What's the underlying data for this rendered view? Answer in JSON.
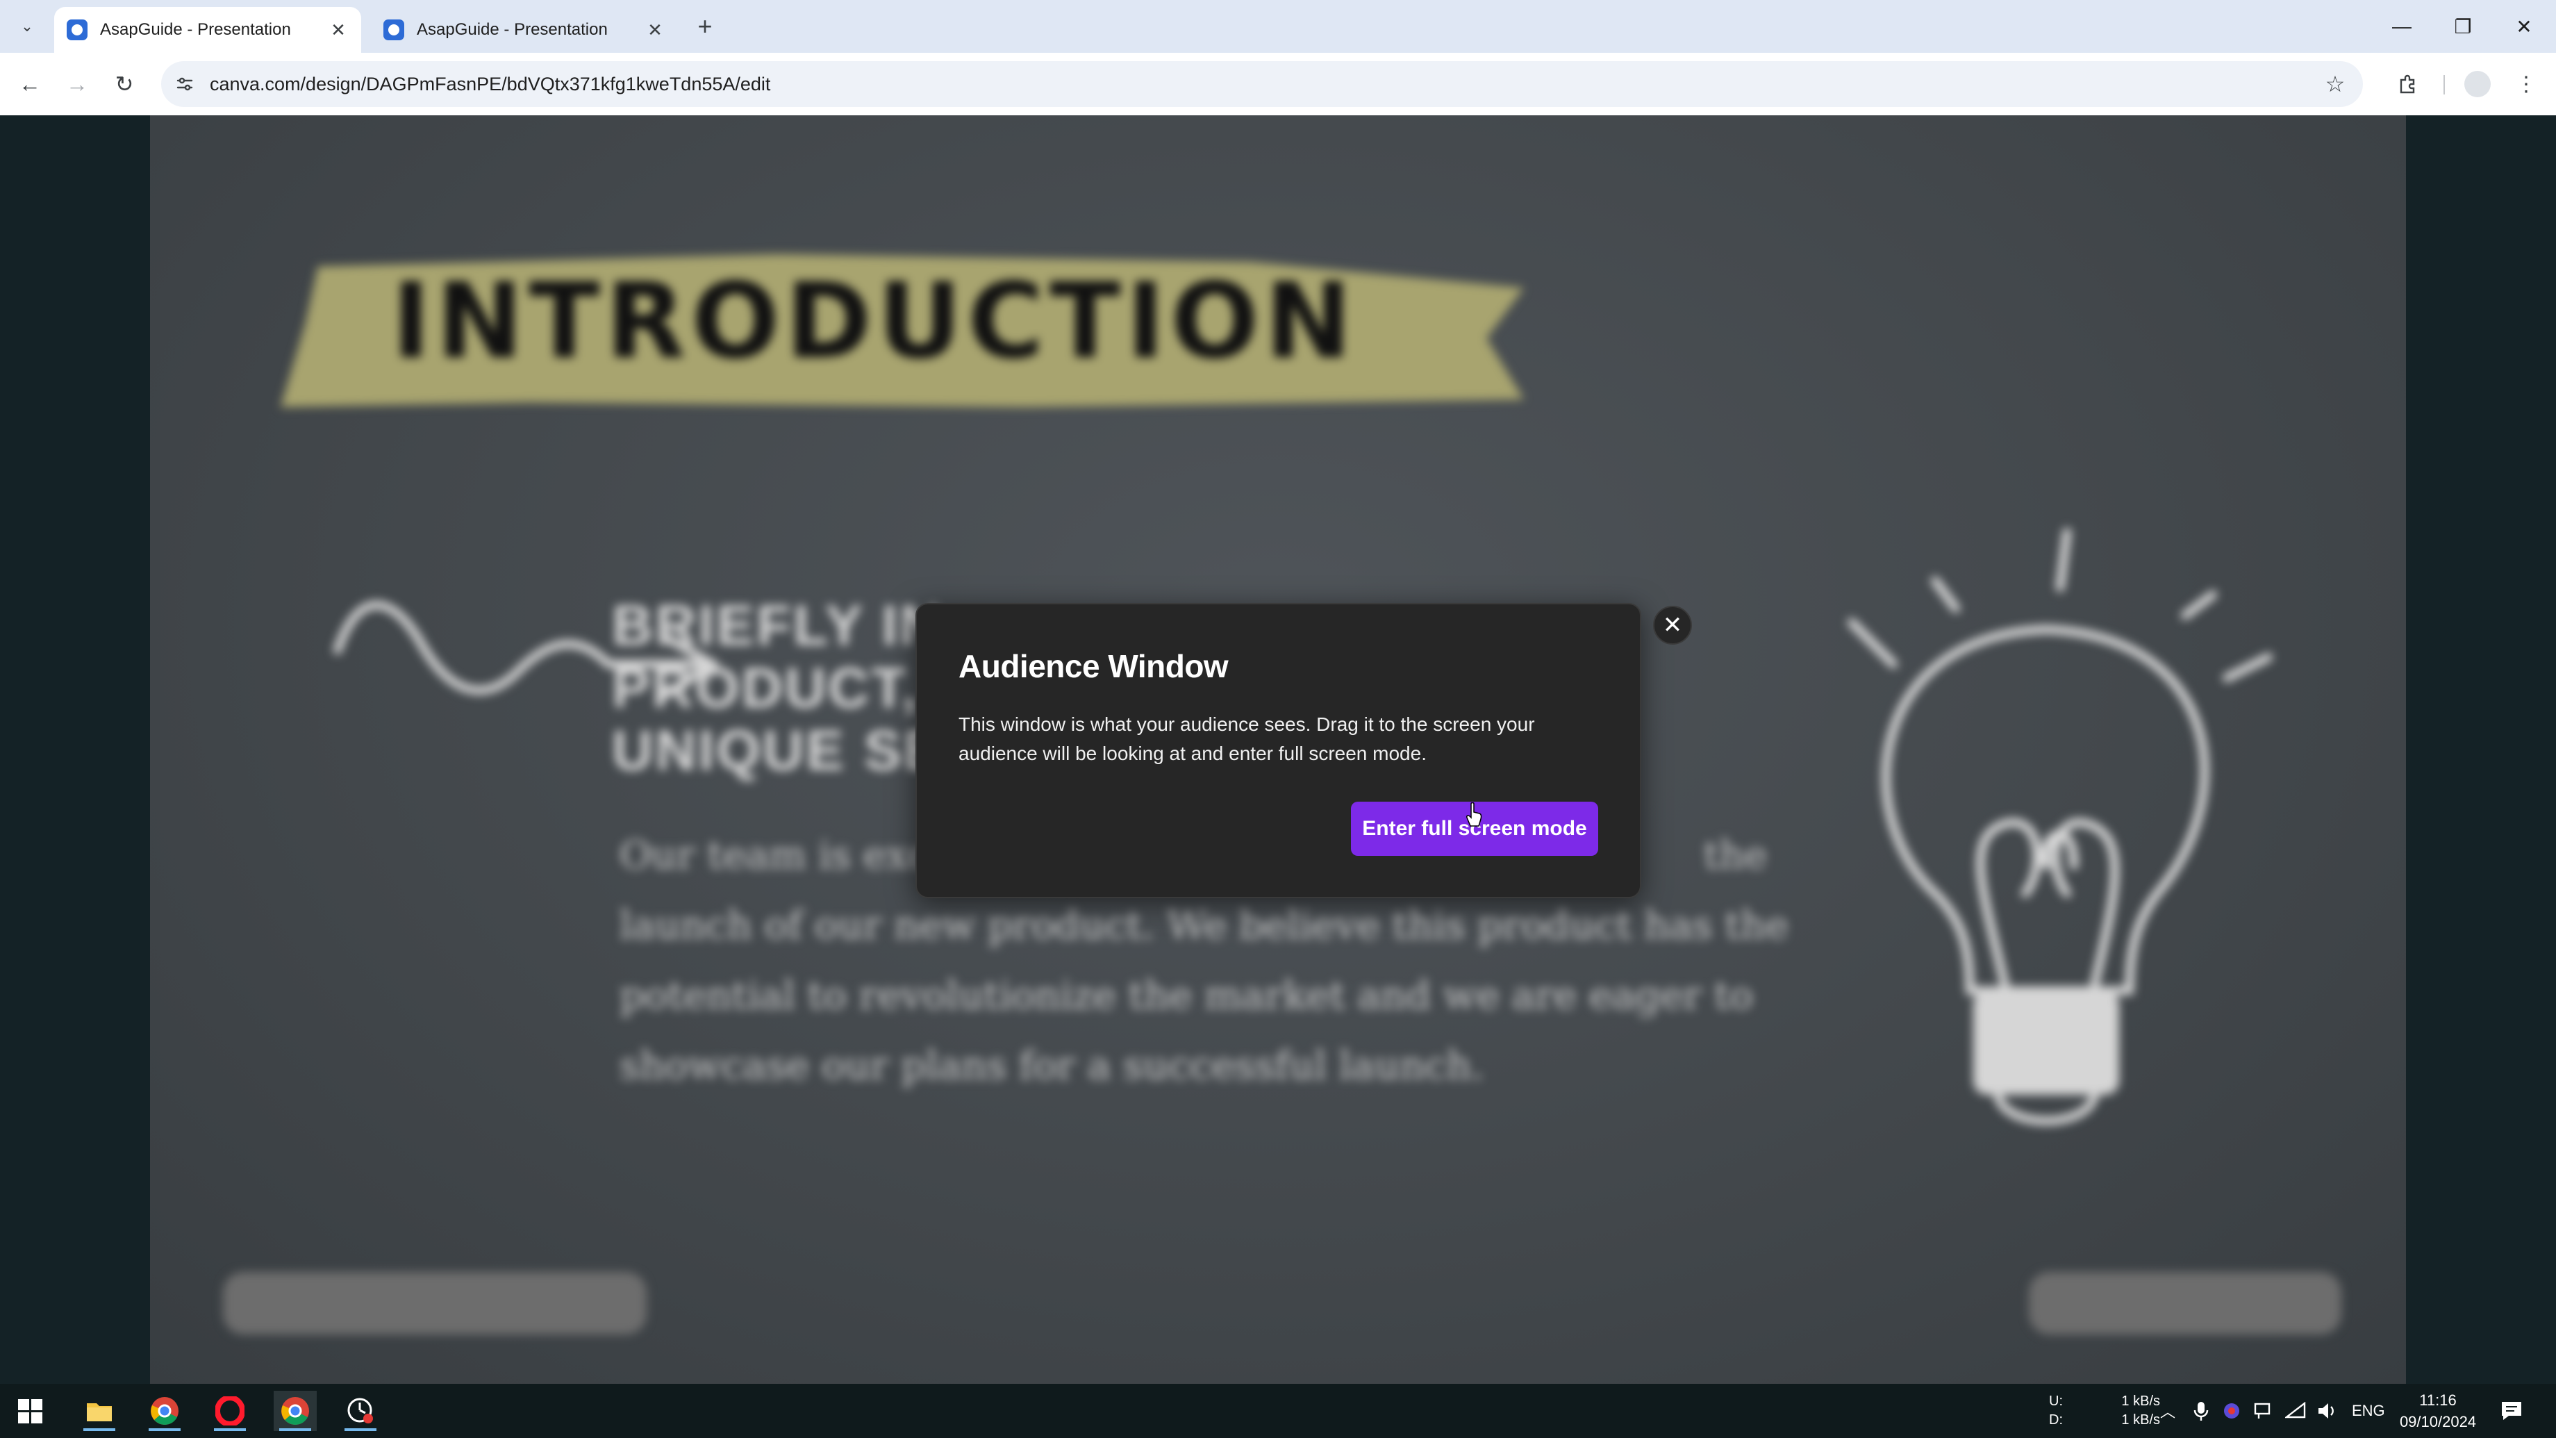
{
  "browser": {
    "tabs": [
      {
        "title": "AsapGuide - Presentation",
        "active": true
      },
      {
        "title": "AsapGuide - Presentation",
        "active": false
      }
    ],
    "url": "canva.com/design/DAGPmFasnPE/bdVQtx371kfg1kweTdn55A/edit"
  },
  "slide": {
    "title": "INTRODUCTION",
    "heading_lines": [
      "BRIEFLY IN",
      "PRODUCT,",
      "UNIQUE SE"
    ],
    "body_lines": [
      "Our team is exci",
      "launch of our new product. We believe this product has the",
      "potential to revolutionize the market and we are eager to",
      "showcase our plans for a successful launch."
    ],
    "body_tail": "the"
  },
  "dialog": {
    "title": "Audience Window",
    "text": "This window is what your audience sees. Drag it to the screen your audience will be looking at and enter full screen mode.",
    "button_label": "Enter full screen mode",
    "button_color": "#7d2ae8"
  },
  "taskbar": {
    "net": {
      "up_label": "U:",
      "down_label": "D:",
      "up": "1 kB/s",
      "down": "1 kB/s"
    },
    "language": "ENG",
    "time": "11:16",
    "date": "09/10/2024"
  }
}
